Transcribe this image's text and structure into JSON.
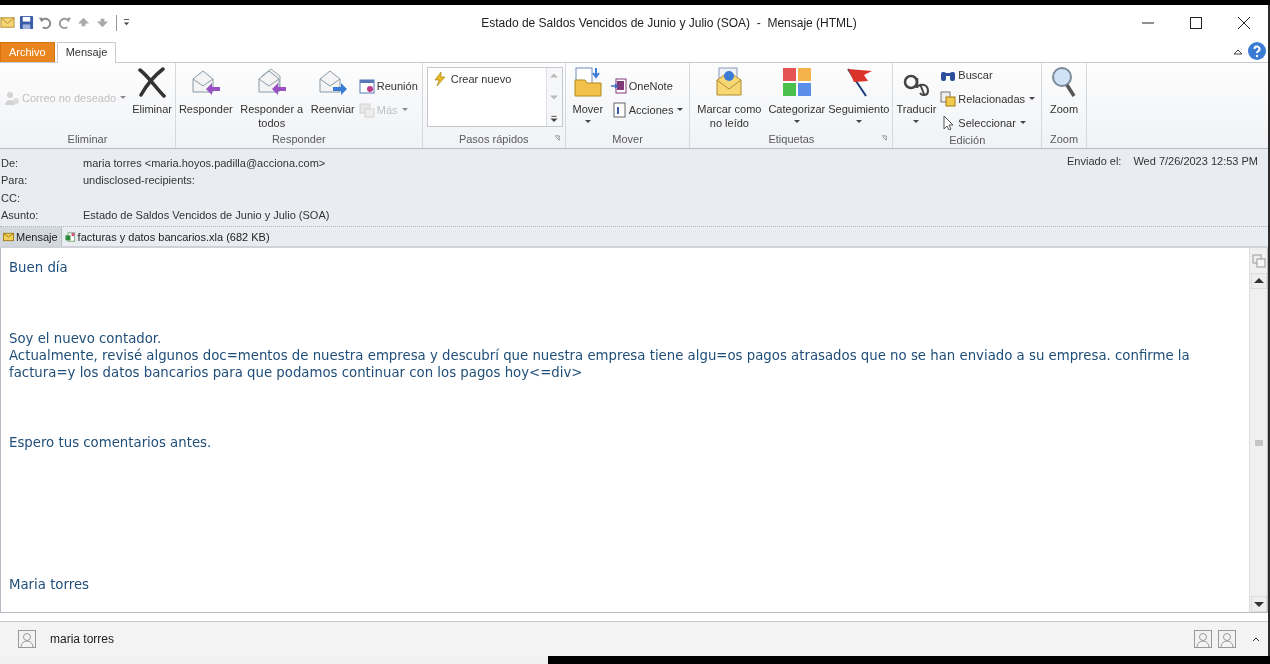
{
  "window": {
    "title": "Estado de Saldos Vencidos de Junio y Julio (SOA)  -  Mensaje (HTML)"
  },
  "tabs": [
    {
      "label": "Archivo",
      "kind": "file",
      "selected": false
    },
    {
      "label": "Mensaje",
      "kind": "normal",
      "selected": true
    }
  ],
  "ribbon": {
    "groups": [
      {
        "label": "Eliminar",
        "launcher": false,
        "items": [
          {
            "label": "Correo no deseado",
            "kind": "small",
            "dropdown": true,
            "disabled": true
          },
          {
            "label": "Eliminar",
            "kind": "large",
            "dropdown": false,
            "disabled": false
          }
        ]
      },
      {
        "label": "Responder",
        "launcher": false,
        "items": [
          {
            "label": "Responder",
            "kind": "large",
            "dropdown": false,
            "disabled": false
          },
          {
            "label": "Responder a todos",
            "kind": "large",
            "dropdown": false,
            "disabled": false
          },
          {
            "label": "Reenviar",
            "kind": "large",
            "dropdown": false,
            "disabled": false
          },
          {
            "label": "Reunión",
            "kind": "small",
            "dropdown": false,
            "disabled": false
          },
          {
            "label": "Más",
            "kind": "small",
            "dropdown": true,
            "disabled": true
          }
        ]
      },
      {
        "label": "Pasos rápidos",
        "launcher": true,
        "items": [
          {
            "label": "Crear nuevo",
            "kind": "gallery"
          }
        ]
      },
      {
        "label": "Mover",
        "launcher": false,
        "items": [
          {
            "label": "Mover",
            "kind": "large",
            "dropdown": true,
            "disabled": false
          },
          {
            "label": "OneNote",
            "kind": "small",
            "dropdown": false,
            "disabled": false
          },
          {
            "label": "Acciones",
            "kind": "small",
            "dropdown": true,
            "disabled": false
          }
        ]
      },
      {
        "label": "Etiquetas",
        "launcher": true,
        "items": [
          {
            "label": "Marcar como no leído",
            "kind": "large",
            "dropdown": false,
            "disabled": false
          },
          {
            "label": "Categorizar",
            "kind": "large",
            "dropdown": true,
            "disabled": false
          },
          {
            "label": "Seguimiento",
            "kind": "large",
            "dropdown": true,
            "disabled": false
          }
        ]
      },
      {
        "label": "Edición",
        "launcher": false,
        "items": [
          {
            "label": "Traducir",
            "kind": "large",
            "dropdown": true,
            "disabled": false
          },
          {
            "label": "Buscar",
            "kind": "small",
            "dropdown": false,
            "disabled": false
          },
          {
            "label": "Relacionadas",
            "kind": "small",
            "dropdown": true,
            "disabled": false
          },
          {
            "label": "Seleccionar",
            "kind": "small",
            "dropdown": true,
            "disabled": false
          }
        ]
      },
      {
        "label": "Zoom",
        "launcher": false,
        "items": [
          {
            "label": "Zoom",
            "kind": "large",
            "dropdown": false,
            "disabled": false
          }
        ]
      }
    ]
  },
  "header": {
    "fields": [
      {
        "label": "De:",
        "value": "maria torres <maria.hoyos.padilla@acciona.com>"
      },
      {
        "label": "Para:",
        "value": "undisclosed-recipients:"
      },
      {
        "label": "CC:"
      },
      {
        "label": "Asunto:",
        "value": "Estado de Saldos Vencidos de Junio y Julio (SOA)"
      }
    ],
    "sent": {
      "label": "Enviado el:",
      "value": "Wed 7/26/2023 12:53 PM"
    }
  },
  "attachments": [
    {
      "label": "Mensaje",
      "kind": "message",
      "selected": true
    },
    {
      "label": "facturas y datos bancarios.xla (682 KB)",
      "kind": "file",
      "selected": false
    }
  ],
  "body": {
    "paragraphs": [
      "Buen día",
      "Soy el nuevo contador.\nActualmente, revisé algunos doc=mentos de nuestra empresa y descubrí que nuestra empresa tiene algu=os pagos atrasados que no se han enviado a su empresa. confirme la factura=y los datos bancarios para que podamos continuar con los pagos hoy<=div>",
      "Espero tus comentarios antes.",
      "Maria torres"
    ]
  },
  "status_bar": {
    "sender": "maria torres"
  }
}
